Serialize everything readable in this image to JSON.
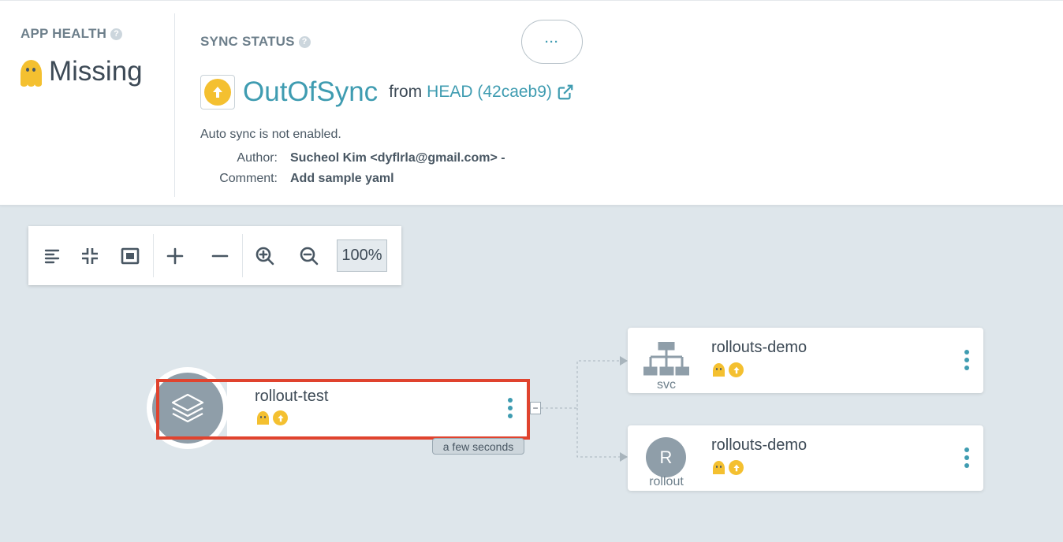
{
  "app_health": {
    "title": "APP HEALTH",
    "help_icon": "?",
    "status": "Missing"
  },
  "sync_status": {
    "title": "SYNC STATUS",
    "help_icon": "?",
    "status": "OutOfSync",
    "from_label": "from",
    "revision": "HEAD (42caeb9)",
    "more_label": "···",
    "auto_sync_note": "Auto sync is not enabled.",
    "author_label": "Author:",
    "author_value": "Sucheol Kim <dyflrla@gmail.com> -",
    "comment_label": "Comment:",
    "comment_value": "Add sample yaml"
  },
  "toolbar": {
    "zoom_level": "100%",
    "buttons": [
      "list-layout-icon",
      "fit-icon",
      "fullscreen-icon",
      "expand-icon",
      "collapse-icon",
      "zoom-in-icon",
      "zoom-out-icon"
    ]
  },
  "graph": {
    "app_node": {
      "name": "rollout-test",
      "age": "a few seconds",
      "collapse_label": "−"
    },
    "children": [
      {
        "name": "rollouts-demo",
        "kind": "svc"
      },
      {
        "name": "rollouts-demo",
        "kind": "rollout",
        "kind_initial": "R"
      }
    ]
  },
  "colors": {
    "accent": "#3f9cb1",
    "warning": "#f4c030",
    "highlight": "#e0432e",
    "canvas": "#dee6eb"
  }
}
